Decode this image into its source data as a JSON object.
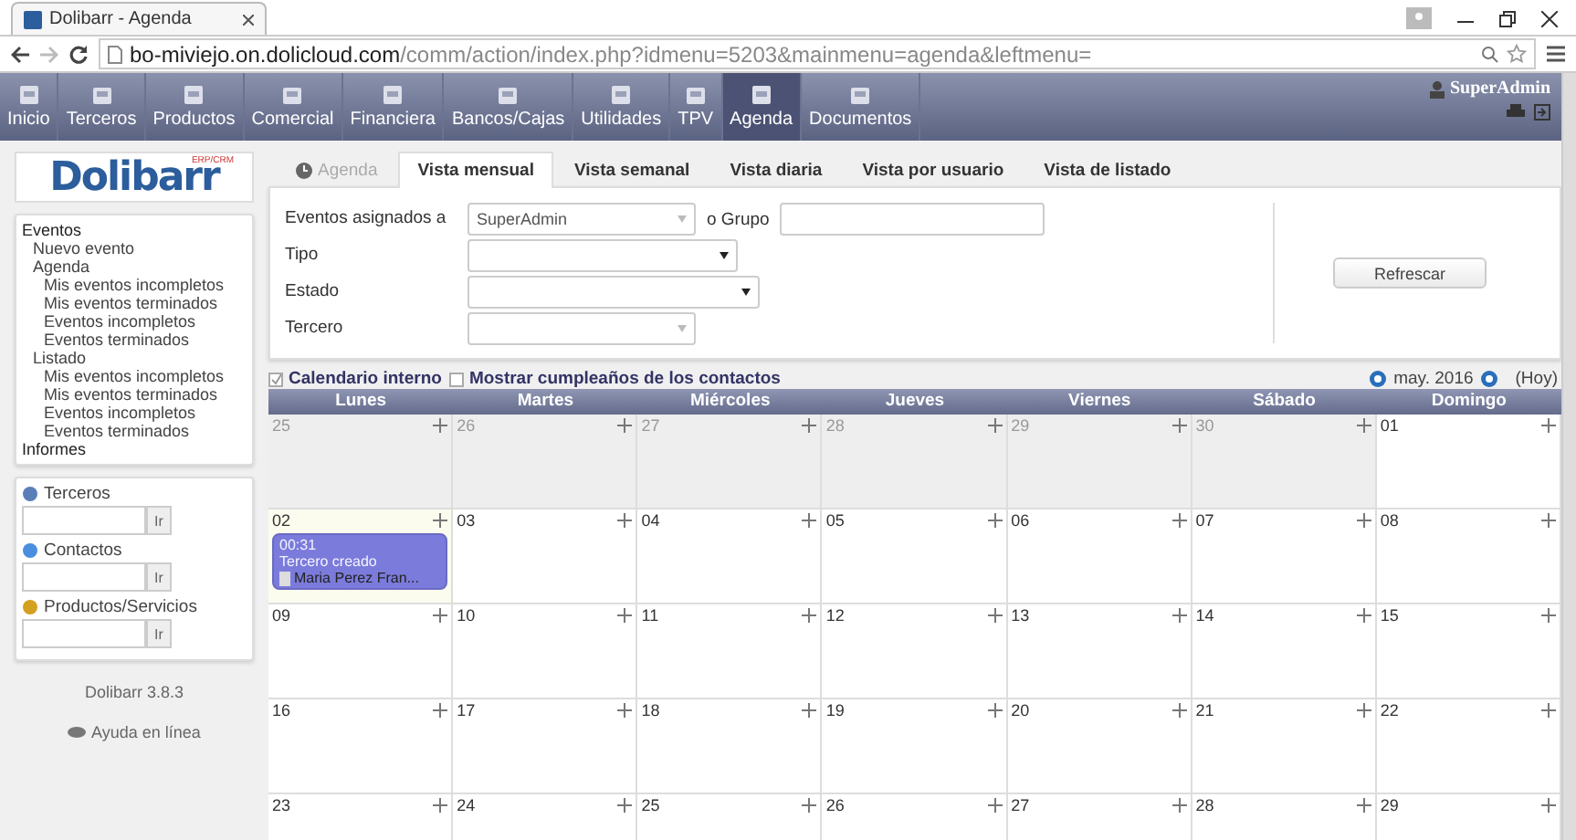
{
  "browser": {
    "tab_title": "Dolibarr - Agenda",
    "url_host": "bo-miviejo.on.dolicloud.com",
    "url_path": "/comm/action/index.php?idmenu=5203&mainmenu=agenda&leftmenu="
  },
  "nav": {
    "items": [
      {
        "label": "Inicio",
        "selected": false
      },
      {
        "label": "Terceros",
        "selected": false
      },
      {
        "label": "Productos",
        "selected": false
      },
      {
        "label": "Comercial",
        "selected": false
      },
      {
        "label": "Financiera",
        "selected": false
      },
      {
        "label": "Bancos/Cajas",
        "selected": false
      },
      {
        "label": "Utilidades",
        "selected": false
      },
      {
        "label": "TPV",
        "selected": false
      },
      {
        "label": "Agenda",
        "selected": true
      },
      {
        "label": "Documentos",
        "selected": false
      }
    ],
    "user": "SuperAdmin"
  },
  "sidebar": {
    "logo": "Dolibarr",
    "logo_tag": "ERP/CRM",
    "menu": [
      {
        "label": "Eventos",
        "children": [
          {
            "label": "Nuevo evento"
          },
          {
            "label": "Agenda",
            "children": [
              {
                "label": "Mis eventos incompletos"
              },
              {
                "label": "Mis eventos terminados"
              },
              {
                "label": "Eventos incompletos"
              },
              {
                "label": "Eventos terminados"
              }
            ]
          },
          {
            "label": "Listado",
            "children": [
              {
                "label": "Mis eventos incompletos"
              },
              {
                "label": "Mis eventos terminados"
              },
              {
                "label": "Eventos incompletos"
              },
              {
                "label": "Eventos terminados"
              }
            ]
          }
        ]
      },
      {
        "label": "Informes"
      }
    ],
    "searches": [
      {
        "label": "Terceros",
        "button": "Ir"
      },
      {
        "label": "Contactos",
        "button": "Ir"
      },
      {
        "label": "Productos/Servicios",
        "button": "Ir"
      }
    ],
    "version": "Dolibarr 3.8.3",
    "help": "Ayuda en línea"
  },
  "tabs": [
    {
      "label": "Agenda",
      "kind": "title",
      "selected": false
    },
    {
      "label": "Vista mensual",
      "kind": "tab",
      "selected": true
    },
    {
      "label": "Vista semanal",
      "kind": "tab",
      "selected": false
    },
    {
      "label": "Vista diaria",
      "kind": "tab",
      "selected": false
    },
    {
      "label": "Vista por usuario",
      "kind": "tab",
      "selected": false
    },
    {
      "label": "Vista de listado",
      "kind": "tab",
      "selected": false
    }
  ],
  "filters": {
    "assigned_label": "Eventos asignados a",
    "assigned_value": "SuperAdmin",
    "group_label": "o Grupo",
    "rows": [
      {
        "label": "Tipo",
        "kind": "select"
      },
      {
        "label": "Estado",
        "kind": "select"
      },
      {
        "label": "Tercero",
        "kind": "combo"
      }
    ],
    "refresh": "Refrescar"
  },
  "options": [
    {
      "label": "Calendario interno",
      "checked": true
    },
    {
      "label": "Mostrar cumpleaños de los contactos",
      "checked": false
    }
  ],
  "month": {
    "label": "may. 2016",
    "today": "(Hoy)"
  },
  "calendar": {
    "weekdays": [
      "Lunes",
      "Martes",
      "Miércoles",
      "Jueves",
      "Viernes",
      "Sábado",
      "Domingo"
    ],
    "weeks": [
      [
        {
          "day": "25",
          "in_month": false
        },
        {
          "day": "26",
          "in_month": false
        },
        {
          "day": "27",
          "in_month": false
        },
        {
          "day": "28",
          "in_month": false
        },
        {
          "day": "29",
          "in_month": false
        },
        {
          "day": "30",
          "in_month": false
        },
        {
          "day": "01",
          "in_month": true
        }
      ],
      [
        {
          "day": "02",
          "in_month": true,
          "today": true,
          "events": [
            {
              "time": "00:31",
              "title": "Tercero creado",
              "contact": "Maria Perez Fran..."
            }
          ]
        },
        {
          "day": "03",
          "in_month": true
        },
        {
          "day": "04",
          "in_month": true
        },
        {
          "day": "05",
          "in_month": true
        },
        {
          "day": "06",
          "in_month": true
        },
        {
          "day": "07",
          "in_month": true
        },
        {
          "day": "08",
          "in_month": true
        }
      ],
      [
        {
          "day": "09",
          "in_month": true
        },
        {
          "day": "10",
          "in_month": true
        },
        {
          "day": "11",
          "in_month": true
        },
        {
          "day": "12",
          "in_month": true
        },
        {
          "day": "13",
          "in_month": true
        },
        {
          "day": "14",
          "in_month": true
        },
        {
          "day": "15",
          "in_month": true
        }
      ],
      [
        {
          "day": "16",
          "in_month": true
        },
        {
          "day": "17",
          "in_month": true
        },
        {
          "day": "18",
          "in_month": true
        },
        {
          "day": "19",
          "in_month": true
        },
        {
          "day": "20",
          "in_month": true
        },
        {
          "day": "21",
          "in_month": true
        },
        {
          "day": "22",
          "in_month": true
        }
      ],
      [
        {
          "day": "23",
          "in_month": true
        },
        {
          "day": "24",
          "in_month": true
        },
        {
          "day": "25",
          "in_month": true
        },
        {
          "day": "26",
          "in_month": true
        },
        {
          "day": "27",
          "in_month": true
        },
        {
          "day": "28",
          "in_month": true
        },
        {
          "day": "29",
          "in_month": true
        }
      ]
    ]
  }
}
